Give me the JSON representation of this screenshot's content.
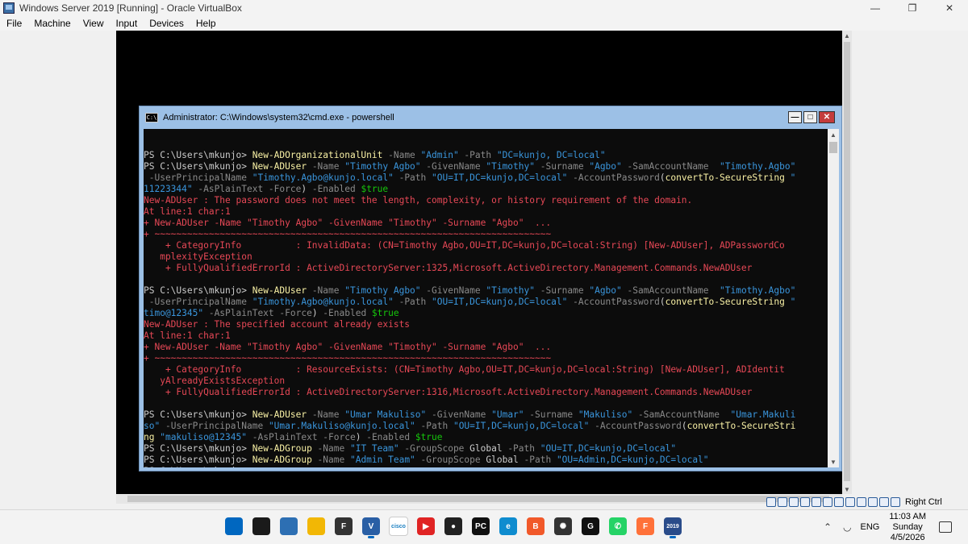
{
  "vbox": {
    "title": "Windows Server 2019 [Running] - Oracle VirtualBox",
    "menu": [
      "File",
      "Machine",
      "View",
      "Input",
      "Devices",
      "Help"
    ],
    "host_key": "Right Ctrl"
  },
  "cmd": {
    "icon_text": "C:\\",
    "title": "Administrator: C:\\Windows\\system32\\cmd.exe - powershell",
    "lines": [
      [],
      [
        [
          "c-def",
          "PS C:\\Users\\mkunjo> "
        ],
        [
          "c-cmd",
          "New-ADOrganizationalUnit"
        ],
        [
          "c-par",
          " -Name "
        ],
        [
          "c-str",
          "\"Admin\""
        ],
        [
          "c-par",
          " -Path "
        ],
        [
          "c-str",
          "\"DC=kunjo, DC=local\""
        ]
      ],
      [
        [
          "c-def",
          "PS C:\\Users\\mkunjo> "
        ],
        [
          "c-cmd",
          "New-ADUser"
        ],
        [
          "c-par",
          " -Name "
        ],
        [
          "c-str",
          "\"Timothy Agbo\""
        ],
        [
          "c-par",
          " -GivenName "
        ],
        [
          "c-str",
          "\"Timothy\""
        ],
        [
          "c-par",
          " -Surname "
        ],
        [
          "c-str",
          "\"Agbo\""
        ],
        [
          "c-par",
          " -SamAccountName  "
        ],
        [
          "c-str",
          "\"Timothy.Agbo\""
        ]
      ],
      [
        [
          "c-par",
          " -UserPrincipalName "
        ],
        [
          "c-str",
          "\"Timothy.Agbo@kunjo.local\""
        ],
        [
          "c-par",
          " -Path "
        ],
        [
          "c-str",
          "\"OU=IT,DC=kunjo,DC=local\""
        ],
        [
          "c-par",
          " -AccountPassword"
        ],
        [
          "c-def",
          "("
        ],
        [
          "c-cmd",
          "convertTo-SecureString"
        ],
        [
          "c-str",
          " \""
        ]
      ],
      [
        [
          "c-str",
          "11223344\""
        ],
        [
          "c-par",
          " -AsPlainText -Force"
        ],
        [
          "c-def",
          ")"
        ],
        [
          "c-par",
          " -Enabled "
        ],
        [
          "c-var",
          "$true"
        ]
      ],
      [
        [
          "c-err",
          "New-ADUser : The password does not meet the length, complexity, or history requirement of the domain."
        ]
      ],
      [
        [
          "c-err",
          "At line:1 char:1"
        ]
      ],
      [
        [
          "c-err",
          "+ New-ADUser -Name \"Timothy Agbo\" -GivenName \"Timothy\" -Surname \"Agbo\"  ..."
        ]
      ],
      [
        [
          "c-err",
          "+ ~~~~~~~~~~~~~~~~~~~~~~~~~~~~~~~~~~~~~~~~~~~~~~~~~~~~~~~~~~~~~~~~~~~~~~~~~"
        ]
      ],
      [
        [
          "c-err",
          "    + CategoryInfo          : InvalidData: (CN=Timothy Agbo,OU=IT,DC=kunjo,DC=local:String) [New-ADUser], ADPasswordCo"
        ]
      ],
      [
        [
          "c-err",
          "   mplexityException"
        ]
      ],
      [
        [
          "c-err",
          "    + FullyQualifiedErrorId : ActiveDirectoryServer:1325,Microsoft.ActiveDirectory.Management.Commands.NewADUser"
        ]
      ],
      [],
      [
        [
          "c-def",
          "PS C:\\Users\\mkunjo> "
        ],
        [
          "c-cmd",
          "New-ADUser"
        ],
        [
          "c-par",
          " -Name "
        ],
        [
          "c-str",
          "\"Timothy Agbo\""
        ],
        [
          "c-par",
          " -GivenName "
        ],
        [
          "c-str",
          "\"Timothy\""
        ],
        [
          "c-par",
          " -Surname "
        ],
        [
          "c-str",
          "\"Agbo\""
        ],
        [
          "c-par",
          " -SamAccountName  "
        ],
        [
          "c-str",
          "\"Timothy.Agbo\""
        ]
      ],
      [
        [
          "c-par",
          " -UserPrincipalName "
        ],
        [
          "c-str",
          "\"Timothy.Agbo@kunjo.local\""
        ],
        [
          "c-par",
          " -Path "
        ],
        [
          "c-str",
          "\"OU=IT,DC=kunjo,DC=local\""
        ],
        [
          "c-par",
          " -AccountPassword"
        ],
        [
          "c-def",
          "("
        ],
        [
          "c-cmd",
          "convertTo-SecureString"
        ],
        [
          "c-str",
          " \""
        ]
      ],
      [
        [
          "c-str",
          "timo@12345\""
        ],
        [
          "c-par",
          " -AsPlainText -Force"
        ],
        [
          "c-def",
          ")"
        ],
        [
          "c-par",
          " -Enabled "
        ],
        [
          "c-var",
          "$true"
        ]
      ],
      [
        [
          "c-err",
          "New-ADUser : The specified account already exists"
        ]
      ],
      [
        [
          "c-err",
          "At line:1 char:1"
        ]
      ],
      [
        [
          "c-err",
          "+ New-ADUser -Name \"Timothy Agbo\" -GivenName \"Timothy\" -Surname \"Agbo\"  ..."
        ]
      ],
      [
        [
          "c-err",
          "+ ~~~~~~~~~~~~~~~~~~~~~~~~~~~~~~~~~~~~~~~~~~~~~~~~~~~~~~~~~~~~~~~~~~~~~~~~~"
        ]
      ],
      [
        [
          "c-err",
          "    + CategoryInfo          : ResourceExists: (CN=Timothy Agbo,OU=IT,DC=kunjo,DC=local:String) [New-ADUser], ADIdentit"
        ]
      ],
      [
        [
          "c-err",
          "   yAlreadyExistsException"
        ]
      ],
      [
        [
          "c-err",
          "    + FullyQualifiedErrorId : ActiveDirectoryServer:1316,Microsoft.ActiveDirectory.Management.Commands.NewADUser"
        ]
      ],
      [],
      [
        [
          "c-def",
          "PS C:\\Users\\mkunjo> "
        ],
        [
          "c-cmd",
          "New-ADUser"
        ],
        [
          "c-par",
          " -Name "
        ],
        [
          "c-str",
          "\"Umar Makuliso\""
        ],
        [
          "c-par",
          " -GivenName "
        ],
        [
          "c-str",
          "\"Umar\""
        ],
        [
          "c-par",
          " -Surname "
        ],
        [
          "c-str",
          "\"Makuliso\""
        ],
        [
          "c-par",
          " -SamAccountName  "
        ],
        [
          "c-str",
          "\"Umar.Makuli"
        ]
      ],
      [
        [
          "c-str",
          "so\""
        ],
        [
          "c-par",
          " -UserPrincipalName "
        ],
        [
          "c-str",
          "\"Umar.Makuliso@kunjo.local\""
        ],
        [
          "c-par",
          " -Path "
        ],
        [
          "c-str",
          "\"OU=IT,DC=kunjo,DC=local\""
        ],
        [
          "c-par",
          " -AccountPassword"
        ],
        [
          "c-def",
          "("
        ],
        [
          "c-cmd",
          "convertTo-SecureStri"
        ]
      ],
      [
        [
          "c-cmd",
          "ng"
        ],
        [
          "c-str",
          " \"makuliso@12345\""
        ],
        [
          "c-par",
          " -AsPlainText -Force"
        ],
        [
          "c-def",
          ")"
        ],
        [
          "c-par",
          " -Enabled "
        ],
        [
          "c-var",
          "$true"
        ]
      ],
      [
        [
          "c-def",
          "PS C:\\Users\\mkunjo> "
        ],
        [
          "c-cmd",
          "New-ADGroup"
        ],
        [
          "c-par",
          " -Name "
        ],
        [
          "c-str",
          "\"IT Team\""
        ],
        [
          "c-par",
          " -GroupScope "
        ],
        [
          "c-def",
          "Global"
        ],
        [
          "c-par",
          " -Path "
        ],
        [
          "c-str",
          "\"OU=IT,DC=kunjo,DC=local\""
        ]
      ],
      [
        [
          "c-def",
          "PS C:\\Users\\mkunjo> "
        ],
        [
          "c-cmd",
          "New-ADGroup"
        ],
        [
          "c-par",
          " -Name "
        ],
        [
          "c-str",
          "\"Admin Team\""
        ],
        [
          "c-par",
          " -GroupScope "
        ],
        [
          "c-def",
          "Global"
        ],
        [
          "c-par",
          " -Path "
        ],
        [
          "c-str",
          "\"OU=Admin,DC=kunjo,DC=local\""
        ]
      ],
      [
        [
          "c-def",
          "PS C:\\Users\\mkunjo> "
        ]
      ]
    ]
  },
  "taskbar": {
    "apps": [
      {
        "name": "start-icon",
        "glyph": "",
        "color": "#0067c0"
      },
      {
        "name": "search-icon",
        "glyph": "",
        "color": "#1a1a1a"
      },
      {
        "name": "task-view-icon",
        "glyph": "",
        "color": "#2d6fb3"
      },
      {
        "name": "file-explorer-icon",
        "glyph": "",
        "color": "#f2b705"
      },
      {
        "name": "terminal-app-icon",
        "glyph": "F",
        "color": "#333333"
      },
      {
        "name": "virtualbox-icon",
        "glyph": "V",
        "color": "#2a5fa5"
      },
      {
        "name": "cisco-icon",
        "glyph": "cisco",
        "color": "#ffffff"
      },
      {
        "name": "youtube-icon",
        "glyph": "▶",
        "color": "#e02424"
      },
      {
        "name": "obs-icon",
        "glyph": "●",
        "color": "#222222"
      },
      {
        "name": "pc-manager-icon",
        "glyph": "PC",
        "color": "#111111"
      },
      {
        "name": "edge-icon",
        "glyph": "e",
        "color": "#0f8ccf"
      },
      {
        "name": "brave-icon",
        "glyph": "B",
        "color": "#f1592a"
      },
      {
        "name": "chatgpt-icon",
        "glyph": "✺",
        "color": "#333333"
      },
      {
        "name": "github-icon",
        "glyph": "G",
        "color": "#111111"
      },
      {
        "name": "whatsapp-icon",
        "glyph": "✆",
        "color": "#25d366"
      },
      {
        "name": "firefox-icon",
        "glyph": "F",
        "color": "#ff7139"
      },
      {
        "name": "windows-server-vm-icon",
        "glyph": "2019",
        "color": "#2a4c8a"
      }
    ],
    "lang": "ENG",
    "time": "11:03 AM",
    "day": "Sunday",
    "date": "4/5/2026"
  }
}
